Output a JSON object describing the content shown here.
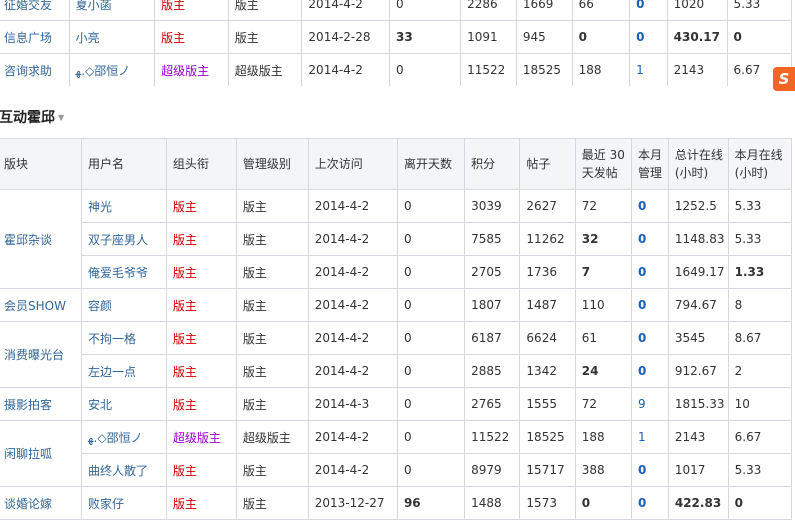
{
  "top_rows": [
    {
      "section": "征婚交友",
      "user": "夏小菡",
      "group": "版主",
      "group_class": "red",
      "level": "版主",
      "visit": "2014-4-2",
      "away": "0",
      "away_bold": false,
      "points": "2286",
      "posts": "1669",
      "recent": "66",
      "recent_bold": false,
      "month_manage": "0",
      "month_manage_class": "b blue",
      "total": "1020",
      "total_bold": false,
      "month": "5.33",
      "month_bold": false
    },
    {
      "section": "信息广场",
      "user": "小亮",
      "group": "版主",
      "group_class": "red",
      "level": "版主",
      "visit": "2014-2-28",
      "away": "33",
      "away_bold": true,
      "points": "1091",
      "posts": "945",
      "recent": "0",
      "recent_bold": true,
      "month_manage": "0",
      "month_manage_class": "b blue",
      "total": "430.17",
      "total_bold": true,
      "month": "0",
      "month_bold": true
    },
    {
      "section": "咨询求助",
      "user": "ﻬ.◇邵恒ノ",
      "group": "超级版主",
      "group_class": "purple",
      "level": "超级版主",
      "visit": "2014-4-2",
      "away": "0",
      "away_bold": false,
      "points": "11522",
      "posts": "18525",
      "recent": "188",
      "recent_bold": false,
      "month_manage": "1",
      "month_manage_class": "blue",
      "total": "2143",
      "total_bold": false,
      "month": "6.67",
      "month_bold": false
    }
  ],
  "section_title": "互动霍邱",
  "sogou_label": "S",
  "headers": [
    "版块",
    "用户名",
    "组头衔",
    "管理级别",
    "上次访问",
    "离开天数",
    "积分",
    "帖子",
    "最近 30 天发帖",
    "本月管理",
    "总计在线(小时)",
    "本月在线(小时)"
  ],
  "rows": [
    {
      "user": "神光",
      "group": "版主",
      "group_class": "red",
      "level": "版主",
      "visit": "2014-4-2",
      "away": "0",
      "away_bold": false,
      "points": "3039",
      "posts": "2627",
      "recent": "72",
      "recent_bold": false,
      "month_manage": "0",
      "month_manage_class": "b blue",
      "total": "1252.5",
      "total_bold": false,
      "month": "5.33",
      "month_bold": false
    },
    {
      "user": "双子座男人",
      "group": "版主",
      "group_class": "red",
      "level": "版主",
      "visit": "2014-4-2",
      "away": "0",
      "away_bold": false,
      "points": "7585",
      "posts": "11262",
      "recent": "32",
      "recent_bold": true,
      "month_manage": "0",
      "month_manage_class": "b blue",
      "total": "1148.83",
      "total_bold": false,
      "month": "5.33",
      "month_bold": false
    },
    {
      "user": "俺爱毛爷爷",
      "group": "版主",
      "group_class": "red",
      "level": "版主",
      "visit": "2014-4-2",
      "away": "0",
      "away_bold": false,
      "points": "2705",
      "posts": "1736",
      "recent": "7",
      "recent_bold": true,
      "month_manage": "0",
      "month_manage_class": "b blue",
      "total": "1649.17",
      "total_bold": false,
      "month": "1.33",
      "month_bold": true
    },
    {
      "user": "容颜",
      "group": "版主",
      "group_class": "red",
      "level": "版主",
      "visit": "2014-4-2",
      "away": "0",
      "away_bold": false,
      "points": "1807",
      "posts": "1487",
      "recent": "110",
      "recent_bold": false,
      "month_manage": "0",
      "month_manage_class": "b blue",
      "total": "794.67",
      "total_bold": false,
      "month": "8",
      "month_bold": false
    },
    {
      "user": "不拘一格",
      "group": "版主",
      "group_class": "red",
      "level": "版主",
      "visit": "2014-4-2",
      "away": "0",
      "away_bold": false,
      "points": "6187",
      "posts": "6624",
      "recent": "61",
      "recent_bold": false,
      "month_manage": "0",
      "month_manage_class": "b blue",
      "total": "3545",
      "total_bold": false,
      "month": "8.67",
      "month_bold": false
    },
    {
      "user": "左边一点",
      "group": "版主",
      "group_class": "red",
      "level": "版主",
      "visit": "2014-4-2",
      "away": "0",
      "away_bold": false,
      "points": "2885",
      "posts": "1342",
      "recent": "24",
      "recent_bold": true,
      "month_manage": "0",
      "month_manage_class": "b blue",
      "total": "912.67",
      "total_bold": false,
      "month": "2",
      "month_bold": false
    },
    {
      "user": "安北",
      "group": "版主",
      "group_class": "red",
      "level": "版主",
      "visit": "2014-4-3",
      "away": "0",
      "away_bold": false,
      "points": "2765",
      "posts": "1555",
      "recent": "72",
      "recent_bold": false,
      "month_manage": "9",
      "month_manage_class": "blue",
      "total": "1815.33",
      "total_bold": false,
      "month": "10",
      "month_bold": false
    },
    {
      "user": "ﻬ.◇邵恒ノ",
      "group": "超级版主",
      "group_class": "purple",
      "level": "超级版主",
      "visit": "2014-4-2",
      "away": "0",
      "away_bold": false,
      "points": "11522",
      "posts": "18525",
      "recent": "188",
      "recent_bold": false,
      "month_manage": "1",
      "month_manage_class": "blue",
      "total": "2143",
      "total_bold": false,
      "month": "6.67",
      "month_bold": false
    },
    {
      "user": "曲终人散了",
      "group": "版主",
      "group_class": "red",
      "level": "版主",
      "visit": "2014-4-2",
      "away": "0",
      "away_bold": false,
      "points": "8979",
      "posts": "15717",
      "recent": "388",
      "recent_bold": false,
      "month_manage": "0",
      "month_manage_class": "b blue",
      "total": "1017",
      "total_bold": false,
      "month": "5.33",
      "month_bold": false
    },
    {
      "user": "败家仔",
      "group": "版主",
      "group_class": "red",
      "level": "版主",
      "visit": "2013-12-27",
      "away": "96",
      "away_bold": true,
      "points": "1488",
      "posts": "1573",
      "recent": "0",
      "recent_bold": true,
      "month_manage": "0",
      "month_manage_class": "b blue",
      "total": "422.83",
      "total_bold": true,
      "month": "0",
      "month_bold": true
    }
  ],
  "sections": [
    {
      "name": "霍邱杂谈",
      "rows": [
        0,
        1,
        2
      ]
    },
    {
      "name": "会员SHOW",
      "rows": [
        3
      ]
    },
    {
      "name": "消费曝光台",
      "rows": [
        4,
        5
      ]
    },
    {
      "name": "摄影拍客",
      "rows": [
        6
      ]
    },
    {
      "name": "闲聊拉呱",
      "rows": [
        7,
        8
      ]
    },
    {
      "name": "谈婚论嫁",
      "rows": [
        9
      ]
    }
  ]
}
